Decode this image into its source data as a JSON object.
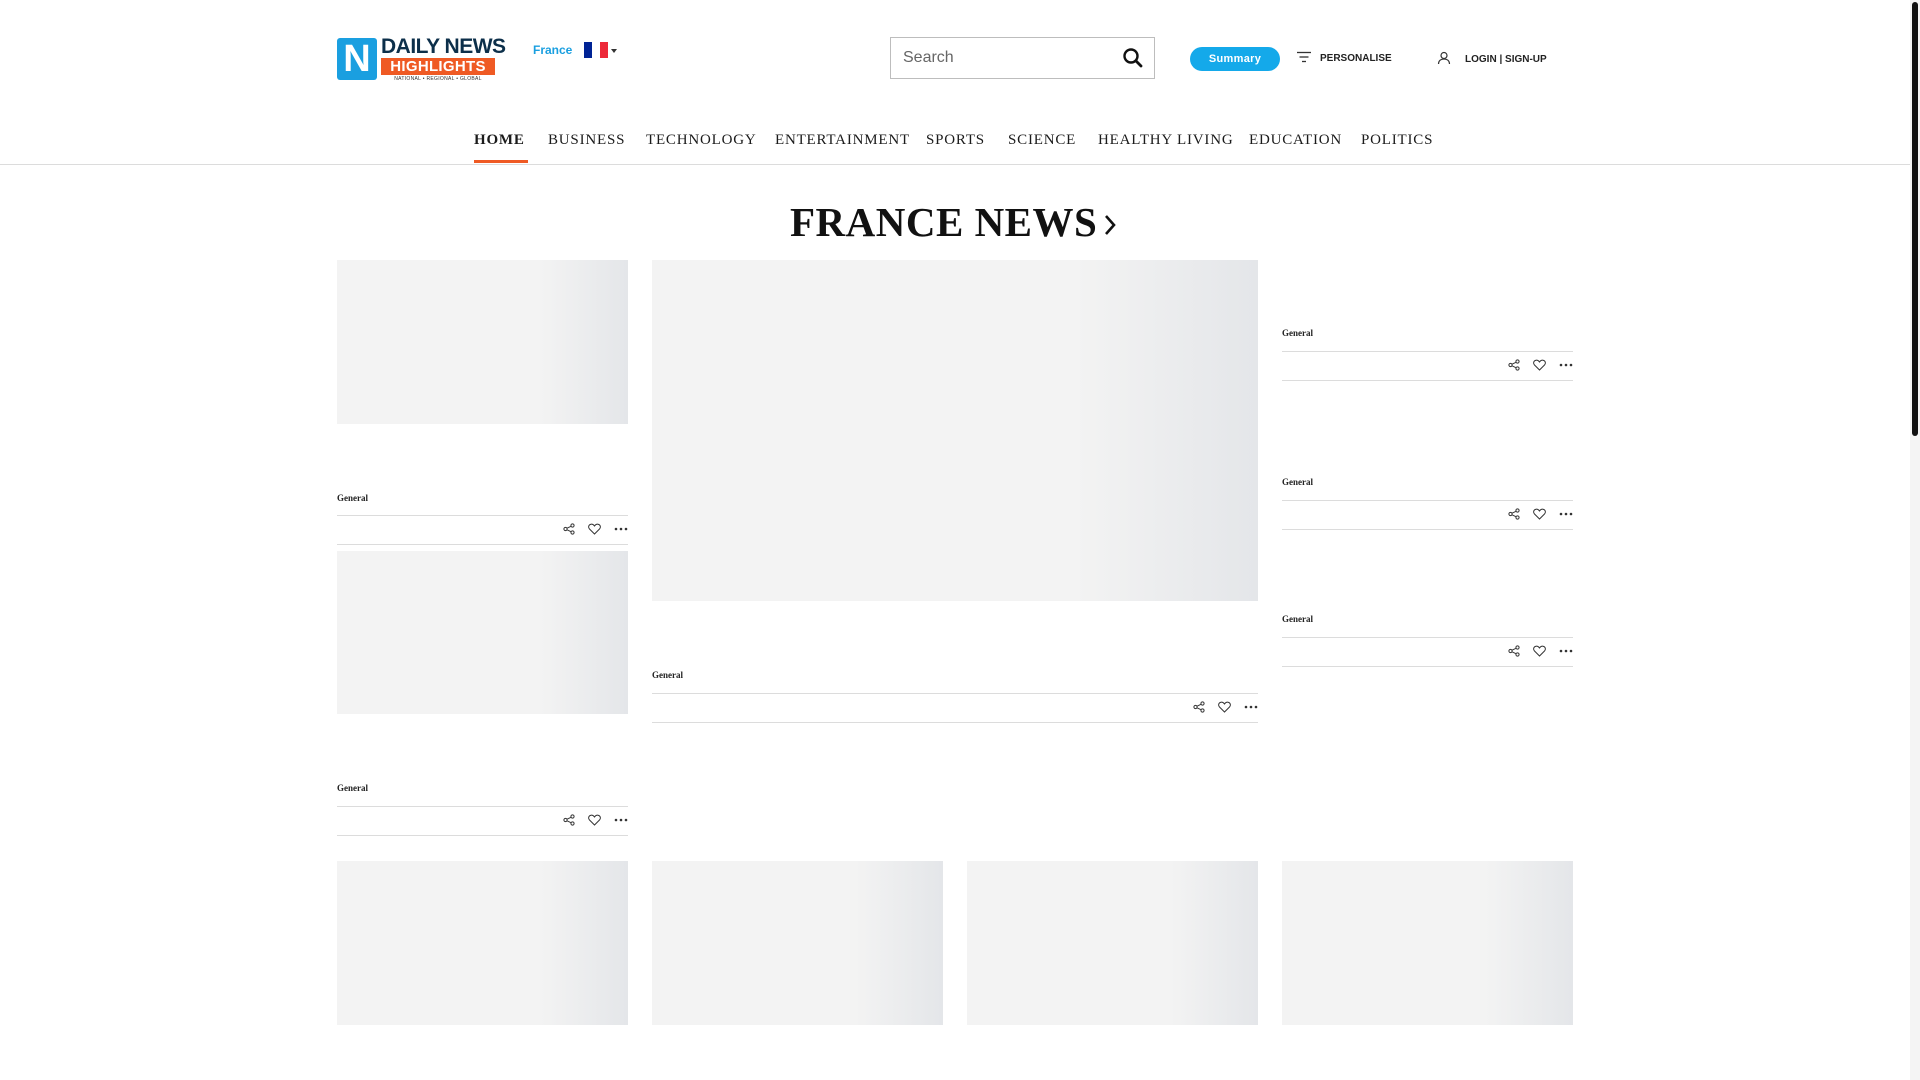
{
  "brand": {
    "logo_mark": "N",
    "logo_line1": "DAILY NEWS",
    "logo_line2": "HIGHLIGHTS",
    "logo_tagline": "NATIONAL • REGIONAL • GLOBAL"
  },
  "header": {
    "country": "France",
    "flag_colors": [
      "#002395",
      "#ffffff",
      "#ed2939"
    ],
    "search_placeholder": "Search",
    "summary_label": "Summary",
    "personalise_label": "PERSONALISE",
    "login_label": "LOGIN | SIGN-UP"
  },
  "nav": {
    "items": [
      {
        "label": "HOME",
        "active": true
      },
      {
        "label": "BUSINESS"
      },
      {
        "label": "TECHNOLOGY"
      },
      {
        "label": "ENTERTAINMENT"
      },
      {
        "label": "SPORTS"
      },
      {
        "label": "SCIENCE"
      },
      {
        "label": "HEALTHY LIVING"
      },
      {
        "label": "EDUCATION"
      },
      {
        "label": "POLITICS"
      }
    ]
  },
  "section": {
    "title": "FRANCE NEWS"
  },
  "cards": [
    {
      "category": "General"
    },
    {
      "category": "General"
    },
    {
      "category": "General"
    },
    {
      "category": "General"
    },
    {
      "category": "General"
    },
    {
      "category": "General"
    }
  ],
  "colors": {
    "accent": "#ef5a24",
    "brand_blue": "#14a9ea",
    "placeholder": "#f3f3f3"
  },
  "icons": [
    "search-icon",
    "filter-icon",
    "user-icon",
    "chevron-right-icon",
    "share-icon",
    "heart-icon",
    "more-icon"
  ]
}
